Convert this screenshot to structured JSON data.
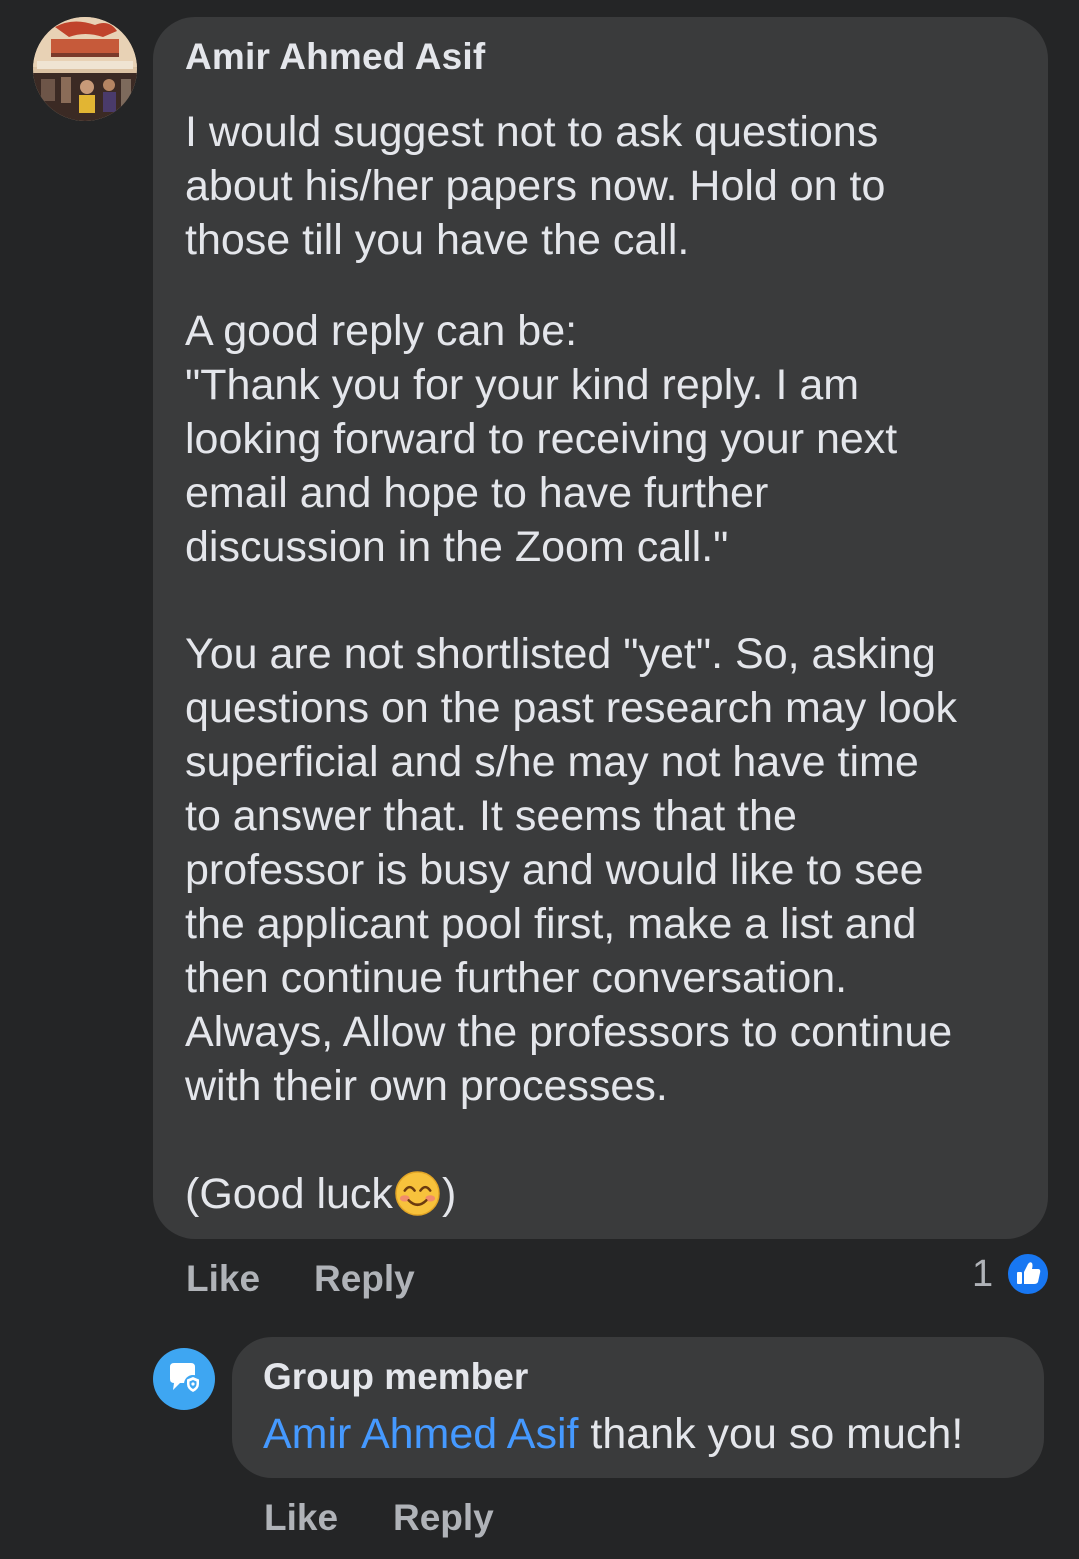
{
  "comment": {
    "author": "Amir Ahmed Asif",
    "paragraphs": [
      [
        "I would suggest not to ask questions",
        "about his/her papers now. Hold on to",
        "those till you have the call."
      ],
      [
        "A good reply can be:",
        "\"Thank you for your kind reply. I am",
        "looking forward to receiving your next",
        "email and hope to have further",
        "discussion in the Zoom call.\""
      ],
      [
        "You are not shortlisted \"yet\". So, asking",
        "questions on the past research may look",
        "superficial and s/he may not have time",
        "to answer that. It seems that the",
        "professor is busy and would like to see",
        "the applicant pool first, make a list and",
        "then continue further conversation.",
        "Always, Allow the professors to continue",
        "with their own processes."
      ]
    ],
    "closing_before": "(Good luck",
    "closing_after": ")",
    "closing_emoji": "smiling-face-emoji",
    "like_label": "Like",
    "reply_label": "Reply",
    "reaction_count": "1",
    "reaction_icon": "thumbs-up-icon"
  },
  "reply": {
    "author": "Group member",
    "mention": "Amir Ahmed Asif",
    "text": " thank you so much!",
    "like_label": "Like",
    "reply_label": "Reply",
    "avatar_icon": "anonymous-member-icon"
  },
  "colors": {
    "background": "#242526",
    "bubble": "#3a3b3c",
    "text": "#e4e6eb",
    "secondary_text": "#b0b3b8",
    "mention": "#4599ff",
    "like_badge": "#1877f2"
  }
}
